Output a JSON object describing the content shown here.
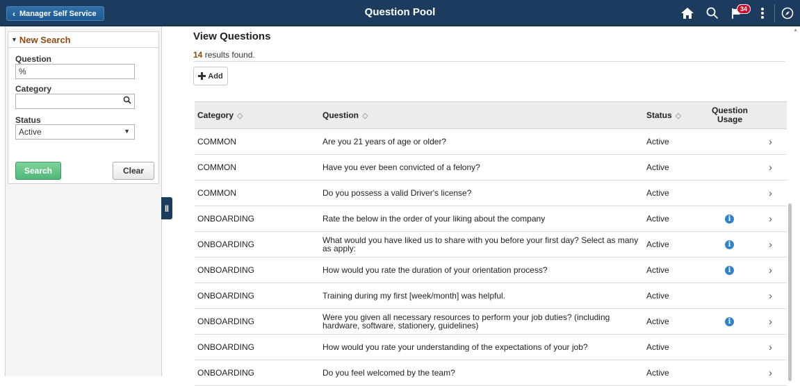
{
  "header": {
    "back_label": "Manager Self Service",
    "title": "Question Pool",
    "notification_count": "34"
  },
  "search": {
    "section_title": "New Search",
    "question_label": "Question",
    "question_value": "%",
    "category_label": "Category",
    "category_value": "",
    "status_label": "Status",
    "status_value": "Active",
    "search_button": "Search",
    "clear_button": "Clear"
  },
  "main": {
    "title": "View Questions",
    "results_count": "14",
    "results_suffix": " results found.",
    "add_label": "Add"
  },
  "grid": {
    "columns": {
      "category": "Category",
      "question": "Question",
      "status": "Status",
      "usage_line1": "Question",
      "usage_line2": "Usage"
    },
    "rows": [
      {
        "category": "COMMON",
        "question": "Are you 21 years of age or older?",
        "status": "Active",
        "usage": false
      },
      {
        "category": "COMMON",
        "question": "Have you ever been convicted of a felony?",
        "status": "Active",
        "usage": false
      },
      {
        "category": "COMMON",
        "question": "Do you possess a valid Driver's license?",
        "status": "Active",
        "usage": false
      },
      {
        "category": "ONBOARDING",
        "question": "Rate the below in the order of your liking about the company",
        "status": "Active",
        "usage": true
      },
      {
        "category": "ONBOARDING",
        "question": "What would you have liked us to share with you before your first day? Select as many as apply:",
        "status": "Active",
        "usage": true
      },
      {
        "category": "ONBOARDING",
        "question": "How would you rate the duration of your orientation process?",
        "status": "Active",
        "usage": true
      },
      {
        "category": "ONBOARDING",
        "question": "Training during my first [week/month] was helpful.",
        "status": "Active",
        "usage": false
      },
      {
        "category": "ONBOARDING",
        "question": "Were you given all necessary resources to perform your job duties? (including hardware, software, stationery, guidelines)",
        "status": "Active",
        "usage": true
      },
      {
        "category": "ONBOARDING",
        "question": "How would you rate your understanding of the expectations of your job?",
        "status": "Active",
        "usage": false
      },
      {
        "category": "ONBOARDING",
        "question": "Do you feel welcomed by the team?",
        "status": "Active",
        "usage": false
      }
    ]
  }
}
